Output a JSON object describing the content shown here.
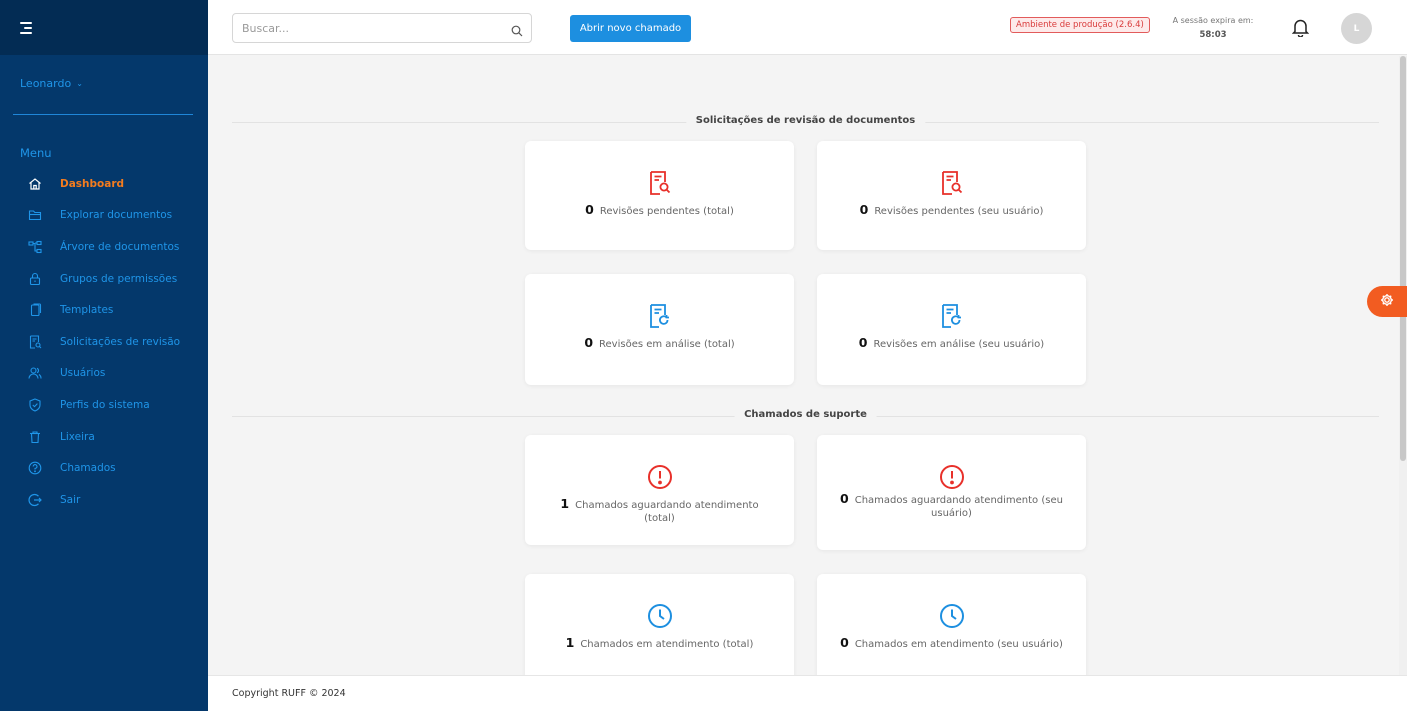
{
  "sidebar": {
    "user_name": "Leonardo",
    "menu_title": "Menu",
    "items": [
      {
        "label": "Dashboard",
        "icon": "home-icon"
      },
      {
        "label": "Explorar documentos",
        "icon": "folder-icon"
      },
      {
        "label": "Árvore de documentos",
        "icon": "tree-icon"
      },
      {
        "label": "Grupos de permissões",
        "icon": "lock-icon"
      },
      {
        "label": "Templates",
        "icon": "copy-icon"
      },
      {
        "label": "Solicitações de revisão",
        "icon": "doc-search-icon"
      },
      {
        "label": "Usuários",
        "icon": "users-icon"
      },
      {
        "label": "Perfis do sistema",
        "icon": "shield-icon"
      },
      {
        "label": "Lixeira",
        "icon": "trash-icon"
      },
      {
        "label": "Chamados",
        "icon": "help-icon"
      },
      {
        "label": "Sair",
        "icon": "logout-icon"
      }
    ],
    "active_index": 0
  },
  "header": {
    "search_placeholder": "Buscar...",
    "new_ticket_label": "Abrir novo chamado",
    "env_badge": "Ambiente de produção (2.6.4)",
    "session_label": "A sessão expira em:",
    "session_time": "58:03",
    "avatar_initial": "L"
  },
  "sections": [
    {
      "title": "Solicitações de revisão de documentos",
      "cards": [
        {
          "value": "0",
          "label": "Revisões pendentes (total)",
          "icon": "doc-search-icon",
          "color": "#e8302a"
        },
        {
          "value": "0",
          "label": "Revisões pendentes (seu usuário)",
          "icon": "doc-search-icon",
          "color": "#e8302a"
        },
        {
          "value": "0",
          "label": "Revisões em análise (total)",
          "icon": "doc-refresh-icon",
          "color": "#1d8fe0"
        },
        {
          "value": "0",
          "label": "Revisões em análise (seu usuário)",
          "icon": "doc-refresh-icon",
          "color": "#1d8fe0"
        }
      ]
    },
    {
      "title": "Chamados de suporte",
      "cards": [
        {
          "value": "1",
          "label": "Chamados aguardando atendimento (total)",
          "icon": "alert-circle-icon",
          "color": "#e8302a"
        },
        {
          "value": "0",
          "label": "Chamados aguardando atendimento (seu usuário)",
          "icon": "alert-circle-icon",
          "color": "#e8302a"
        },
        {
          "value": "1",
          "label": "Chamados em atendimento (total)",
          "icon": "clock-icon",
          "color": "#1d8fe0"
        },
        {
          "value": "0",
          "label": "Chamados em atendimento (seu usuário)",
          "icon": "clock-icon",
          "color": "#1d8fe0"
        }
      ]
    }
  ],
  "footer": {
    "copyright": "Copyright RUFF © 2024"
  },
  "colors": {
    "sidebar_bg": "#04386b",
    "sidebar_top_bg": "#032c54",
    "accent_blue": "#1d8fe0",
    "active_orange": "#f47c1e",
    "alert_red": "#e8302a",
    "fab_orange": "#f25c21"
  }
}
